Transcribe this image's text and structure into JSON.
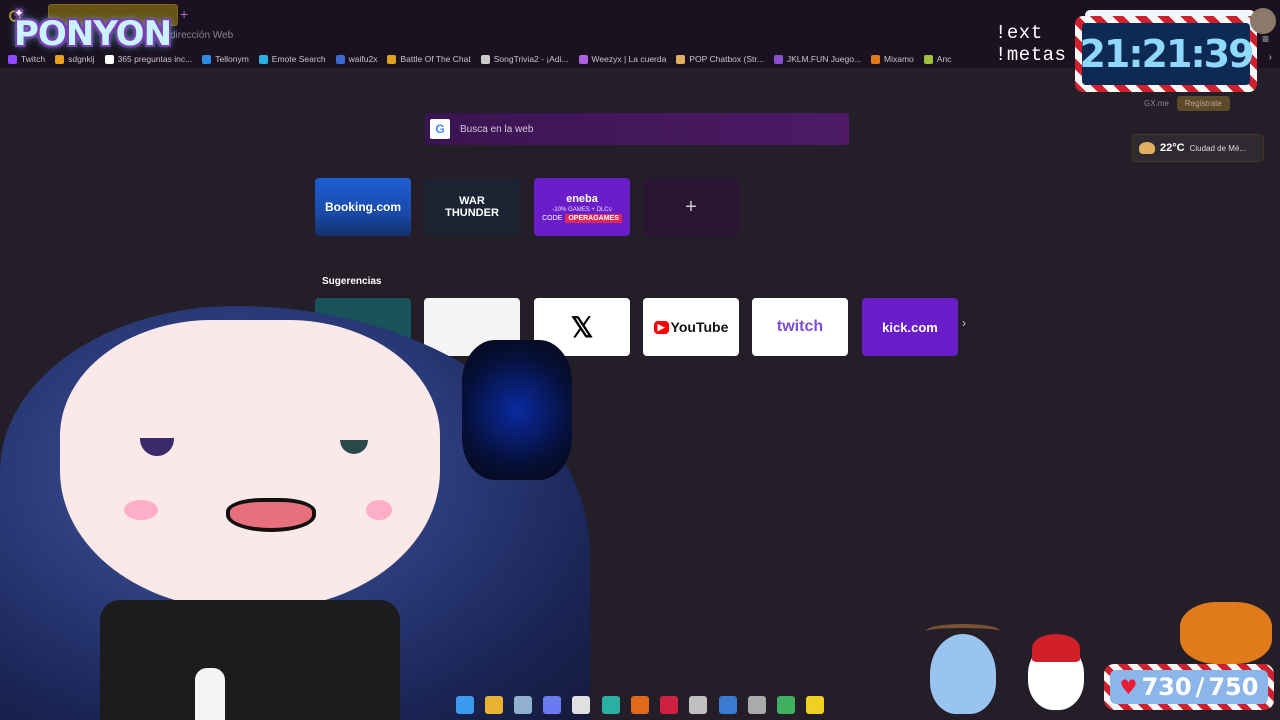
{
  "browser": {
    "address_placeholder": "dirección Web",
    "new_tab_symbol": "+",
    "bookmarks": [
      {
        "label": "Twitch",
        "color": "#9146ff"
      },
      {
        "label": "sdgnkij",
        "color": "#e8a020"
      },
      {
        "label": "365 preguntas inc...",
        "color": "#ffffff"
      },
      {
        "label": "Tellonym",
        "color": "#2a8be0"
      },
      {
        "label": "Emote Search",
        "color": "#2ab0e0"
      },
      {
        "label": "waifu2x",
        "color": "#3a6ad0"
      },
      {
        "label": "Battle Of The Chat",
        "color": "#e0a020"
      },
      {
        "label": "SongTrivia2 - ¡Adi...",
        "color": "#cccccc"
      },
      {
        "label": "Weezyx | La cuerda",
        "color": "#b060e0"
      },
      {
        "label": "POP Chatbox (Str...",
        "color": "#e0b060"
      },
      {
        "label": "JKLM.FUN Juego...",
        "color": "#8a50d0"
      },
      {
        "label": "Mixamo",
        "color": "#e07a1a"
      },
      {
        "label": "Anc",
        "color": "#a0c040"
      }
    ],
    "bookmarks_more_symbol": "›",
    "menu_symbol": "≡"
  },
  "overlay": {
    "logo_text": "PONYON",
    "commands": [
      "!ext",
      "!metas"
    ],
    "clock": "21:21:39",
    "goal_current": "730",
    "goal_target": "750",
    "goal_separator": "/"
  },
  "sidebar_widgets": {
    "gx_label": "GX.me",
    "register_label": "Regístrate",
    "weather_temp": "22°C",
    "weather_city": "Ciudad de Mé..."
  },
  "speed_dial": {
    "search_placeholder": "Busca en la web",
    "google_letter": "G",
    "tiles": {
      "booking": "Booking.com",
      "war_line1": "WAR",
      "war_line2": "THUNDER",
      "eneba_name": "eneba",
      "eneba_sub": "-10% GAMES + DLCs",
      "eneba_code_label": "CODE",
      "eneba_code": "OPERAGAMES",
      "add_symbol": "+"
    },
    "suggestions_title": "Sugerencias",
    "suggestions": {
      "x": "𝕏",
      "youtube_icon": "▶",
      "youtube": "YouTube",
      "twitch": "twitch",
      "kick": "kick.com"
    },
    "next_symbol": "›"
  },
  "taskbar": {
    "icons": [
      {
        "name": "windows-start-icon",
        "color": "#3a9af0"
      },
      {
        "name": "file-explorer-icon",
        "color": "#e8b230"
      },
      {
        "name": "steam-icon",
        "color": "#8fb0d0"
      },
      {
        "name": "discord-icon",
        "color": "#6a7af0"
      },
      {
        "name": "chatgpt-icon",
        "color": "#e0e0e0"
      },
      {
        "name": "edge-icon",
        "color": "#2ab0a0"
      },
      {
        "name": "firefox-icon",
        "color": "#e06a1a"
      },
      {
        "name": "opera-gx-icon",
        "color": "#d02040"
      },
      {
        "name": "tradingview-icon",
        "color": "#c0c0c0"
      },
      {
        "name": "vscode-icon",
        "color": "#3a7ad0"
      },
      {
        "name": "obs-icon",
        "color": "#aaaaaa"
      },
      {
        "name": "app-green-icon",
        "color": "#40b060"
      },
      {
        "name": "sticky-notes-icon",
        "color": "#f0d020"
      }
    ]
  }
}
